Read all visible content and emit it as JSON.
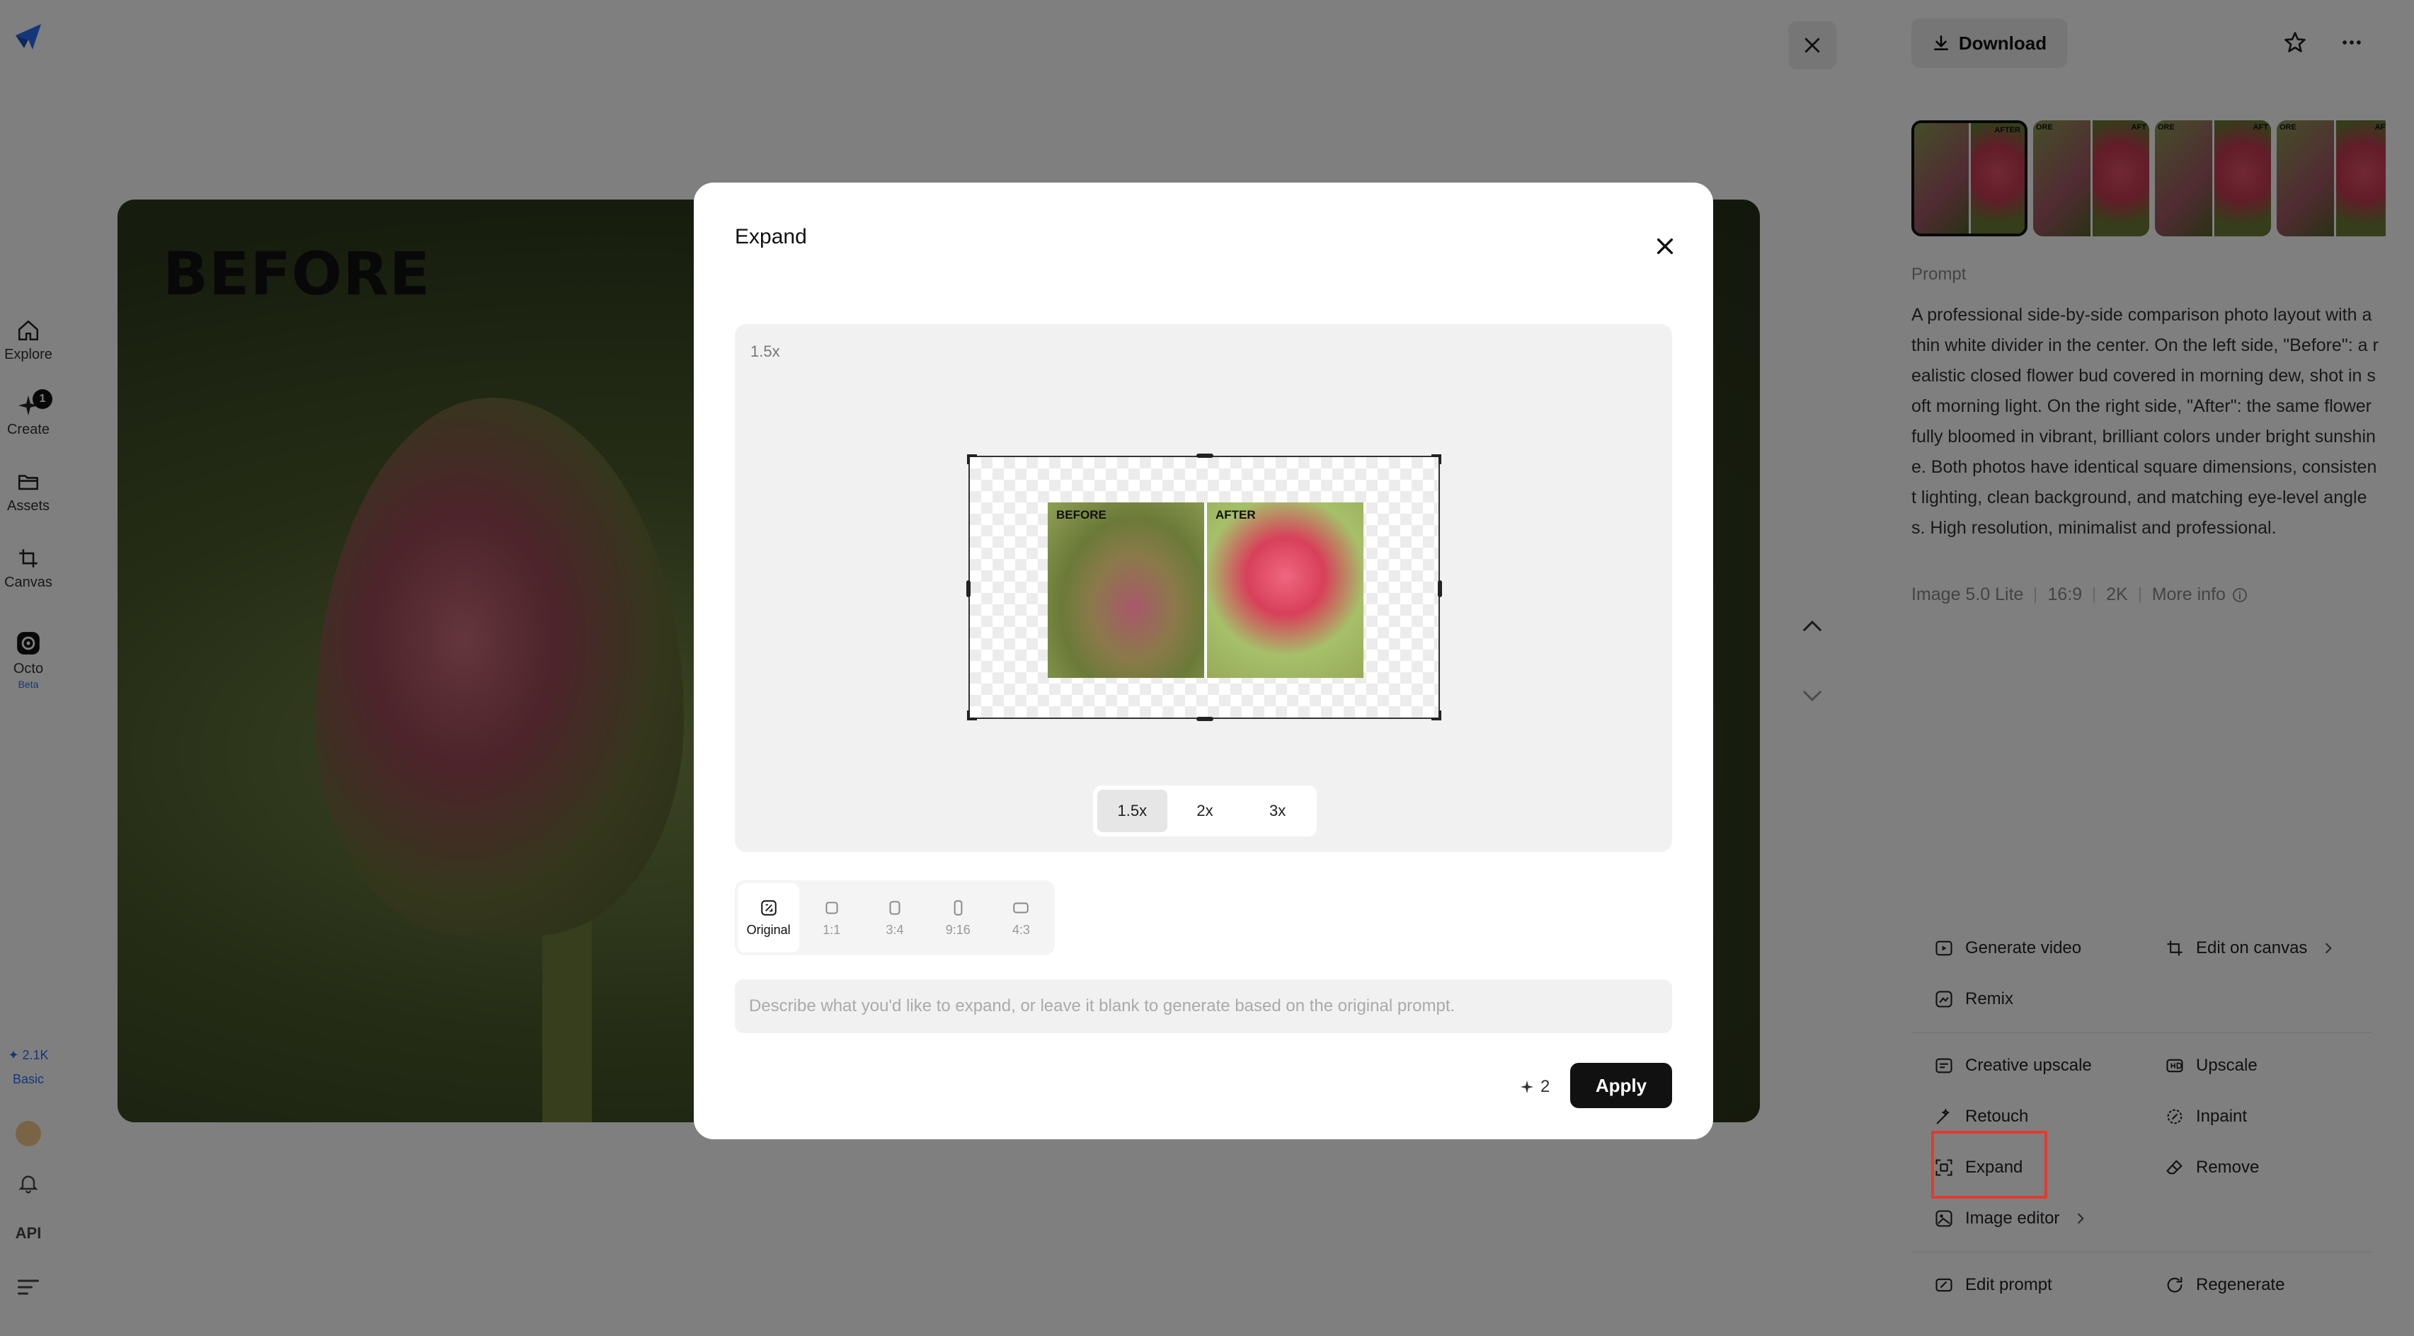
{
  "rail": {
    "items": [
      {
        "label": "Explore"
      },
      {
        "label": "Create",
        "badge": "1"
      },
      {
        "label": "Assets"
      },
      {
        "label": "Canvas"
      },
      {
        "label": "Octo",
        "tag": "Beta"
      }
    ],
    "credits": "✦ 2.1K",
    "plan": "Basic",
    "api_label": "API"
  },
  "main": {
    "image_label": "BEFORE"
  },
  "right_panel": {
    "download_label": "Download",
    "thumbnail_labels": [
      "AFTER",
      "ORE",
      "AFT",
      "ORE",
      "AFT",
      "ORE",
      "AFT"
    ],
    "prompt_heading": "Prompt",
    "prompt_text": "A professional side-by-side comparison photo layout with a thin white divider in the center. On the left side, \"Before\": a realistic closed flower bud covered in morning dew, shot in soft morning light. On the right side, \"After\": the same flower fully bloomed in vibrant, brilliant colors under bright sunshine. Both photos have identical square dimensions, consistent lighting, clean background, and matching eye-level angles. High resolution, minimalist and professional.",
    "meta": {
      "model": "Image 5.0 Lite",
      "ratio": "16:9",
      "resolution": "2K",
      "more_info": "More info"
    },
    "actions": {
      "generate_video": "Generate video",
      "edit_on_canvas": "Edit on canvas",
      "remix": "Remix",
      "creative_upscale": "Creative upscale",
      "upscale": "Upscale",
      "retouch": "Retouch",
      "inpaint": "Inpaint",
      "expand": "Expand",
      "remove": "Remove",
      "image_editor": "Image editor",
      "edit_prompt": "Edit prompt",
      "regenerate": "Regenerate"
    }
  },
  "modal": {
    "title": "Expand",
    "scale_indicator": "1.5x",
    "preview_before_label": "BEFORE",
    "preview_after_label": "AFTER",
    "scale_options": [
      {
        "label": "1.5x",
        "active": true
      },
      {
        "label": "2x",
        "active": false
      },
      {
        "label": "3x",
        "active": false
      }
    ],
    "ratio_options": [
      {
        "label": "Original",
        "active": true
      },
      {
        "label": "1:1",
        "active": false
      },
      {
        "label": "3:4",
        "active": false
      },
      {
        "label": "9:16",
        "active": false
      },
      {
        "label": "4:3",
        "active": false
      }
    ],
    "prompt_placeholder": "Describe what you'd like to expand, or leave it blank to generate based on the original prompt.",
    "prompt_value": "",
    "cost": "2",
    "apply_label": "Apply"
  },
  "colors": {
    "highlight": "#e33b2e",
    "accent_blue": "#2a6ef5",
    "primary": "#111111"
  }
}
